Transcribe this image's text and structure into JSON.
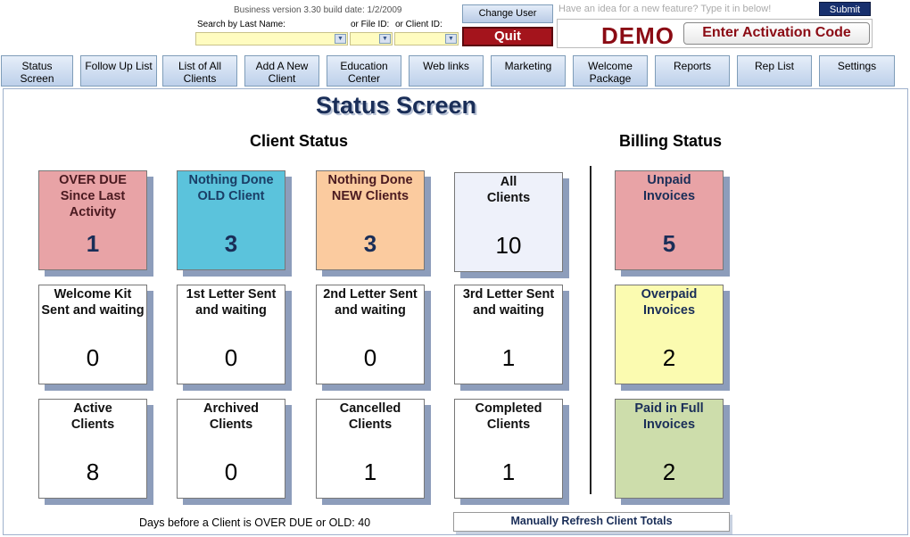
{
  "header": {
    "version_text": "Business version 3.30  build date: 1/2/2009",
    "search_last_name_label": "Search by Last Name:",
    "file_id_label": "or File ID:",
    "client_id_label": "or Client ID:",
    "change_user_label": "Change User",
    "quit_label": "Quit",
    "idea_placeholder": "Have an idea for a new feature? Type it in below!",
    "submit_label": "Submit",
    "demo_text": "DEMO",
    "activation_label": "Enter Activation Code"
  },
  "nav": [
    "Status\nScreen",
    "Follow Up List",
    "List of All\nClients",
    "Add A New\nClient",
    "Education\nCenter",
    "Web links",
    "Marketing",
    "Welcome\nPackage",
    "Reports",
    "Rep List",
    "Settings"
  ],
  "main": {
    "title": "Status Screen",
    "client_status_heading": "Client Status",
    "billing_status_heading": "Billing Status",
    "days_label": "Days before a Client is OVER DUE or OLD:  40",
    "refresh_label": "Manually Refresh Client Totals"
  },
  "colors": {
    "overdue": "#e8a3a6",
    "old_client": "#5bc3dc",
    "new_clients": "#fbcb9f",
    "all_clients": "#eef1fa",
    "unpaid": "#e8a3a6",
    "overpaid": "#fbfbb0",
    "paid": "#cdddab",
    "title_text": "#1a2e58",
    "demo_red": "#8b0b14"
  },
  "client_tiles": [
    {
      "label": "OVER DUE\nSince Last\nActivity",
      "count": "1"
    },
    {
      "label": "Nothing Done\nOLD Client",
      "count": "3"
    },
    {
      "label": "Nothing Done\nNEW Clients",
      "count": "3"
    },
    {
      "label": "All\nClients",
      "count": "10"
    },
    {
      "label": "Welcome Kit\nSent and waiting",
      "count": "0"
    },
    {
      "label": "1st Letter Sent\nand waiting",
      "count": "0"
    },
    {
      "label": "2nd Letter Sent\nand waiting",
      "count": "0"
    },
    {
      "label": "3rd Letter Sent\nand waiting",
      "count": "1"
    },
    {
      "label": "Active\nClients",
      "count": "8"
    },
    {
      "label": "Archived\nClients",
      "count": "0"
    },
    {
      "label": "Cancelled\nClients",
      "count": "1"
    },
    {
      "label": "Completed\nClients",
      "count": "1"
    }
  ],
  "billing_tiles": [
    {
      "label": "Unpaid\nInvoices",
      "count": "5"
    },
    {
      "label": "Overpaid\nInvoices",
      "count": "2"
    },
    {
      "label": "Paid in Full\nInvoices",
      "count": "2"
    }
  ]
}
